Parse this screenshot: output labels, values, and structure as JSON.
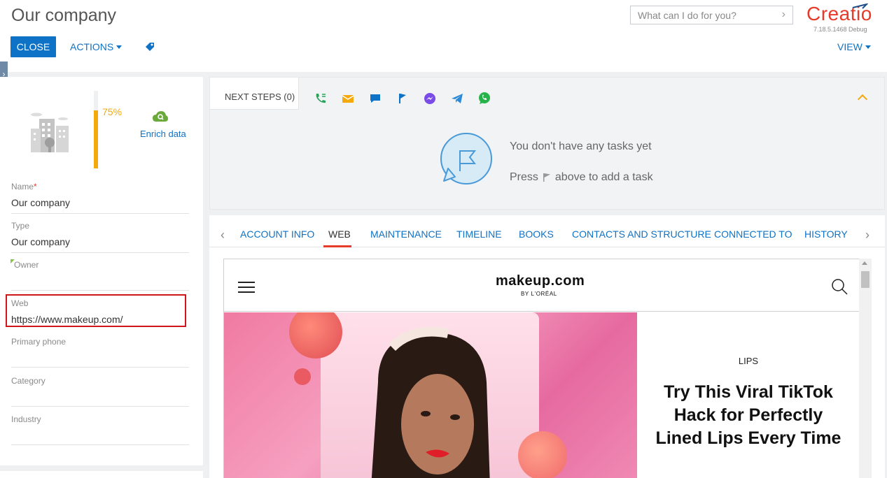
{
  "header": {
    "title": "Our company",
    "close_label": "CLOSE",
    "actions_label": "ACTIONS",
    "search_placeholder": "What can I do for you?",
    "logo_text": "Creatio",
    "version": "7.18.5.1468 Debug",
    "view_label": "VIEW"
  },
  "profile": {
    "completeness": "75%",
    "completeness_value": 0.75,
    "enrich_label": "Enrich data",
    "fields": {
      "name_label": "Name",
      "name_required": "*",
      "name_value": "Our company",
      "type_label": "Type",
      "type_value": "Our company",
      "owner_label": "Owner",
      "owner_value": "",
      "web_label": "Web",
      "web_value": "https://www.makeup.com/",
      "phone_label": "Primary phone",
      "phone_value": "",
      "category_label": "Category",
      "category_value": "",
      "industry_label": "Industry",
      "industry_value": ""
    }
  },
  "next_steps": {
    "label": "NEXT STEPS (0)",
    "empty_title": "You don't have any tasks yet",
    "empty_press": "Press",
    "empty_rest": "above to add a task",
    "icons": [
      "phone-icon",
      "email-icon",
      "chat-icon",
      "flag-icon",
      "messenger-icon",
      "telegram-icon",
      "whatsapp-icon"
    ]
  },
  "tabs": [
    {
      "label": "ACCOUNT INFO"
    },
    {
      "label": "WEB"
    },
    {
      "label": "MAINTENANCE"
    },
    {
      "label": "TIMELINE"
    },
    {
      "label": "BOOKS"
    },
    {
      "label": "CONTACTS AND STRUCTURE"
    },
    {
      "label": "CONNECTED TO"
    },
    {
      "label": "HISTORY"
    }
  ],
  "active_tab": "WEB",
  "website": {
    "logo": "makeup.com",
    "logo_sub": "BY L'ORÉAL",
    "category": "LIPS",
    "headline": "Try This Viral TikTok Hack for Perfectly Lined Lips Every Time"
  },
  "colors": {
    "accent": "#0e72c6",
    "brand": "#e63a2a",
    "progress": "#f4a90d",
    "highlight_border": "#d0161b"
  }
}
